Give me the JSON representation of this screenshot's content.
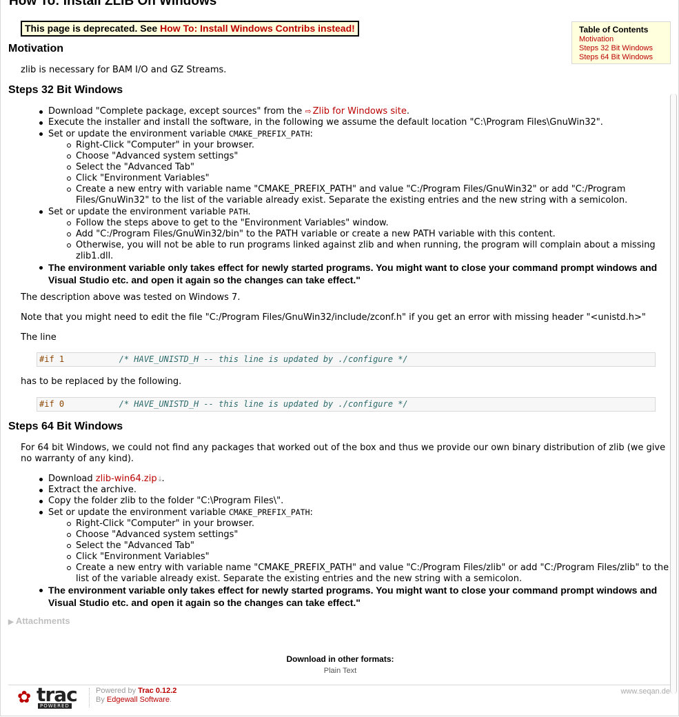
{
  "page": {
    "title": "How To: Install ZLIB On Windows"
  },
  "deprecated": {
    "text": "This page is deprecated. See ",
    "link": "How To: Install Windows Contribs instead!"
  },
  "toc": {
    "title": "Table of Contents",
    "items": [
      "Motivation",
      "Steps 32 Bit Windows",
      "Steps 64 Bit Windows"
    ]
  },
  "motivation": {
    "heading": "Motivation",
    "text": "zlib is necessary for BAM I/O and GZ Streams."
  },
  "steps32": {
    "heading": "Steps 32 Bit Windows",
    "download_prefix": "Download \"Complete package, except sources\" from the ",
    "download_link": "Zlib for Windows site",
    "download_suffix": ".",
    "execute": "Execute the installer and install the software, in the following we assume the default location \"C:\\Program Files\\GnuWin32\".",
    "set_cmake_prefix": "Set or update the environment variable ",
    "cmake_var": "CMAKE_PREFIX_PATH",
    "cmake_suffix": ":",
    "cmake_steps": [
      "Right-Click \"Computer\" in your browser.",
      "Choose \"Advanced system settings\"",
      "Select the \"Advanced Tab\"",
      "Click \"Environment Variables\"",
      "Create a new entry with variable name \"CMAKE_PREFIX_PATH\" and value \"C:/Program Files/GnuWin32\" or add \"C:/Program Files/GnuWin32\" to the list of the variable already exist. Separate the existing entries and the new string with a semicolon."
    ],
    "set_path_prefix": "Set or update the environment variable ",
    "path_var": "PATH",
    "path_suffix": ".",
    "path_steps": [
      "Follow the steps above to get to the \"Environment Variables\" window.",
      "Add \"C:/Program Files/GnuWin32/bin\" to the PATH variable or create a new PATH variable with this content.",
      "Otherwise, you will not be able to run programs linked against zlib and when running, the program will complain about a missing zlib1.dll."
    ],
    "note": "The environment variable only takes effect for newly started programs. You might want to close your command prompt windows and Visual Studio etc. and open it again so the changes can take effect.\"",
    "tested": "The description above was tested on Windows 7.",
    "edit_note": "Note that you might need to edit the file \"C:/Program Files/GnuWin32/include/zconf.h\" if you get an error with missing header \"<unistd.h>\"",
    "the_line": "The line",
    "code1_kw": "#if 1",
    "code1_comment": "/* HAVE_UNISTD_H -- this line is updated by ./configure */",
    "replaced": "has to be replaced by the following.",
    "code2_kw": "#if 0",
    "code2_comment": "/* HAVE_UNISTD_H -- this line is updated by ./configure */"
  },
  "steps64": {
    "heading": "Steps 64 Bit Windows",
    "intro": "For 64 bit Windows, we could not find any packages that worked out of the box and thus we provide our own binary distribution of zlib (we give no warranty of any kind).",
    "download_prefix": "Download ",
    "download_link": "zlib-win64.zip",
    "download_suffix": ".",
    "extract": "Extract the archive.",
    "copy": "Copy the folder zlib to the folder \"C:\\Program Files\\\".",
    "set_cmake_prefix": "Set or update the environment variable ",
    "cmake_var": "CMAKE_PREFIX_PATH",
    "cmake_suffix": ":",
    "cmake_steps": [
      "Right-Click \"Computer\" in your browser.",
      "Choose \"Advanced system settings\"",
      "Select the \"Advanced Tab\"",
      "Click \"Environment Variables\"",
      "Create a new entry with variable name \"CMAKE_PREFIX_PATH\" and value \"C:/Program Files/zlib\" or add \"C:/Program Files/zlib\" to the list of the variable already exist. Separate the existing entries and the new string with a semicolon."
    ],
    "note": "The environment variable only takes effect for newly started programs. You might want to close your command prompt windows and Visual Studio etc. and open it again so the changes can take effect.\""
  },
  "attachments": {
    "label": "Attachments"
  },
  "formats": {
    "title": "Download in other formats:",
    "item": "Plain Text"
  },
  "footer": {
    "logo_text": "trac",
    "logo_tag": "POWERED",
    "powered_by": "Powered by ",
    "trac_version": "Trac 0.12.2",
    "by": "By ",
    "edgewall": "Edgewall Software",
    "by_suffix": ".",
    "site": "www.seqan.de"
  },
  "icons": {
    "external": "external-link-icon",
    "download": "download-icon",
    "disclosure": "disclosure-triangle-icon",
    "paw": "paw-icon"
  }
}
